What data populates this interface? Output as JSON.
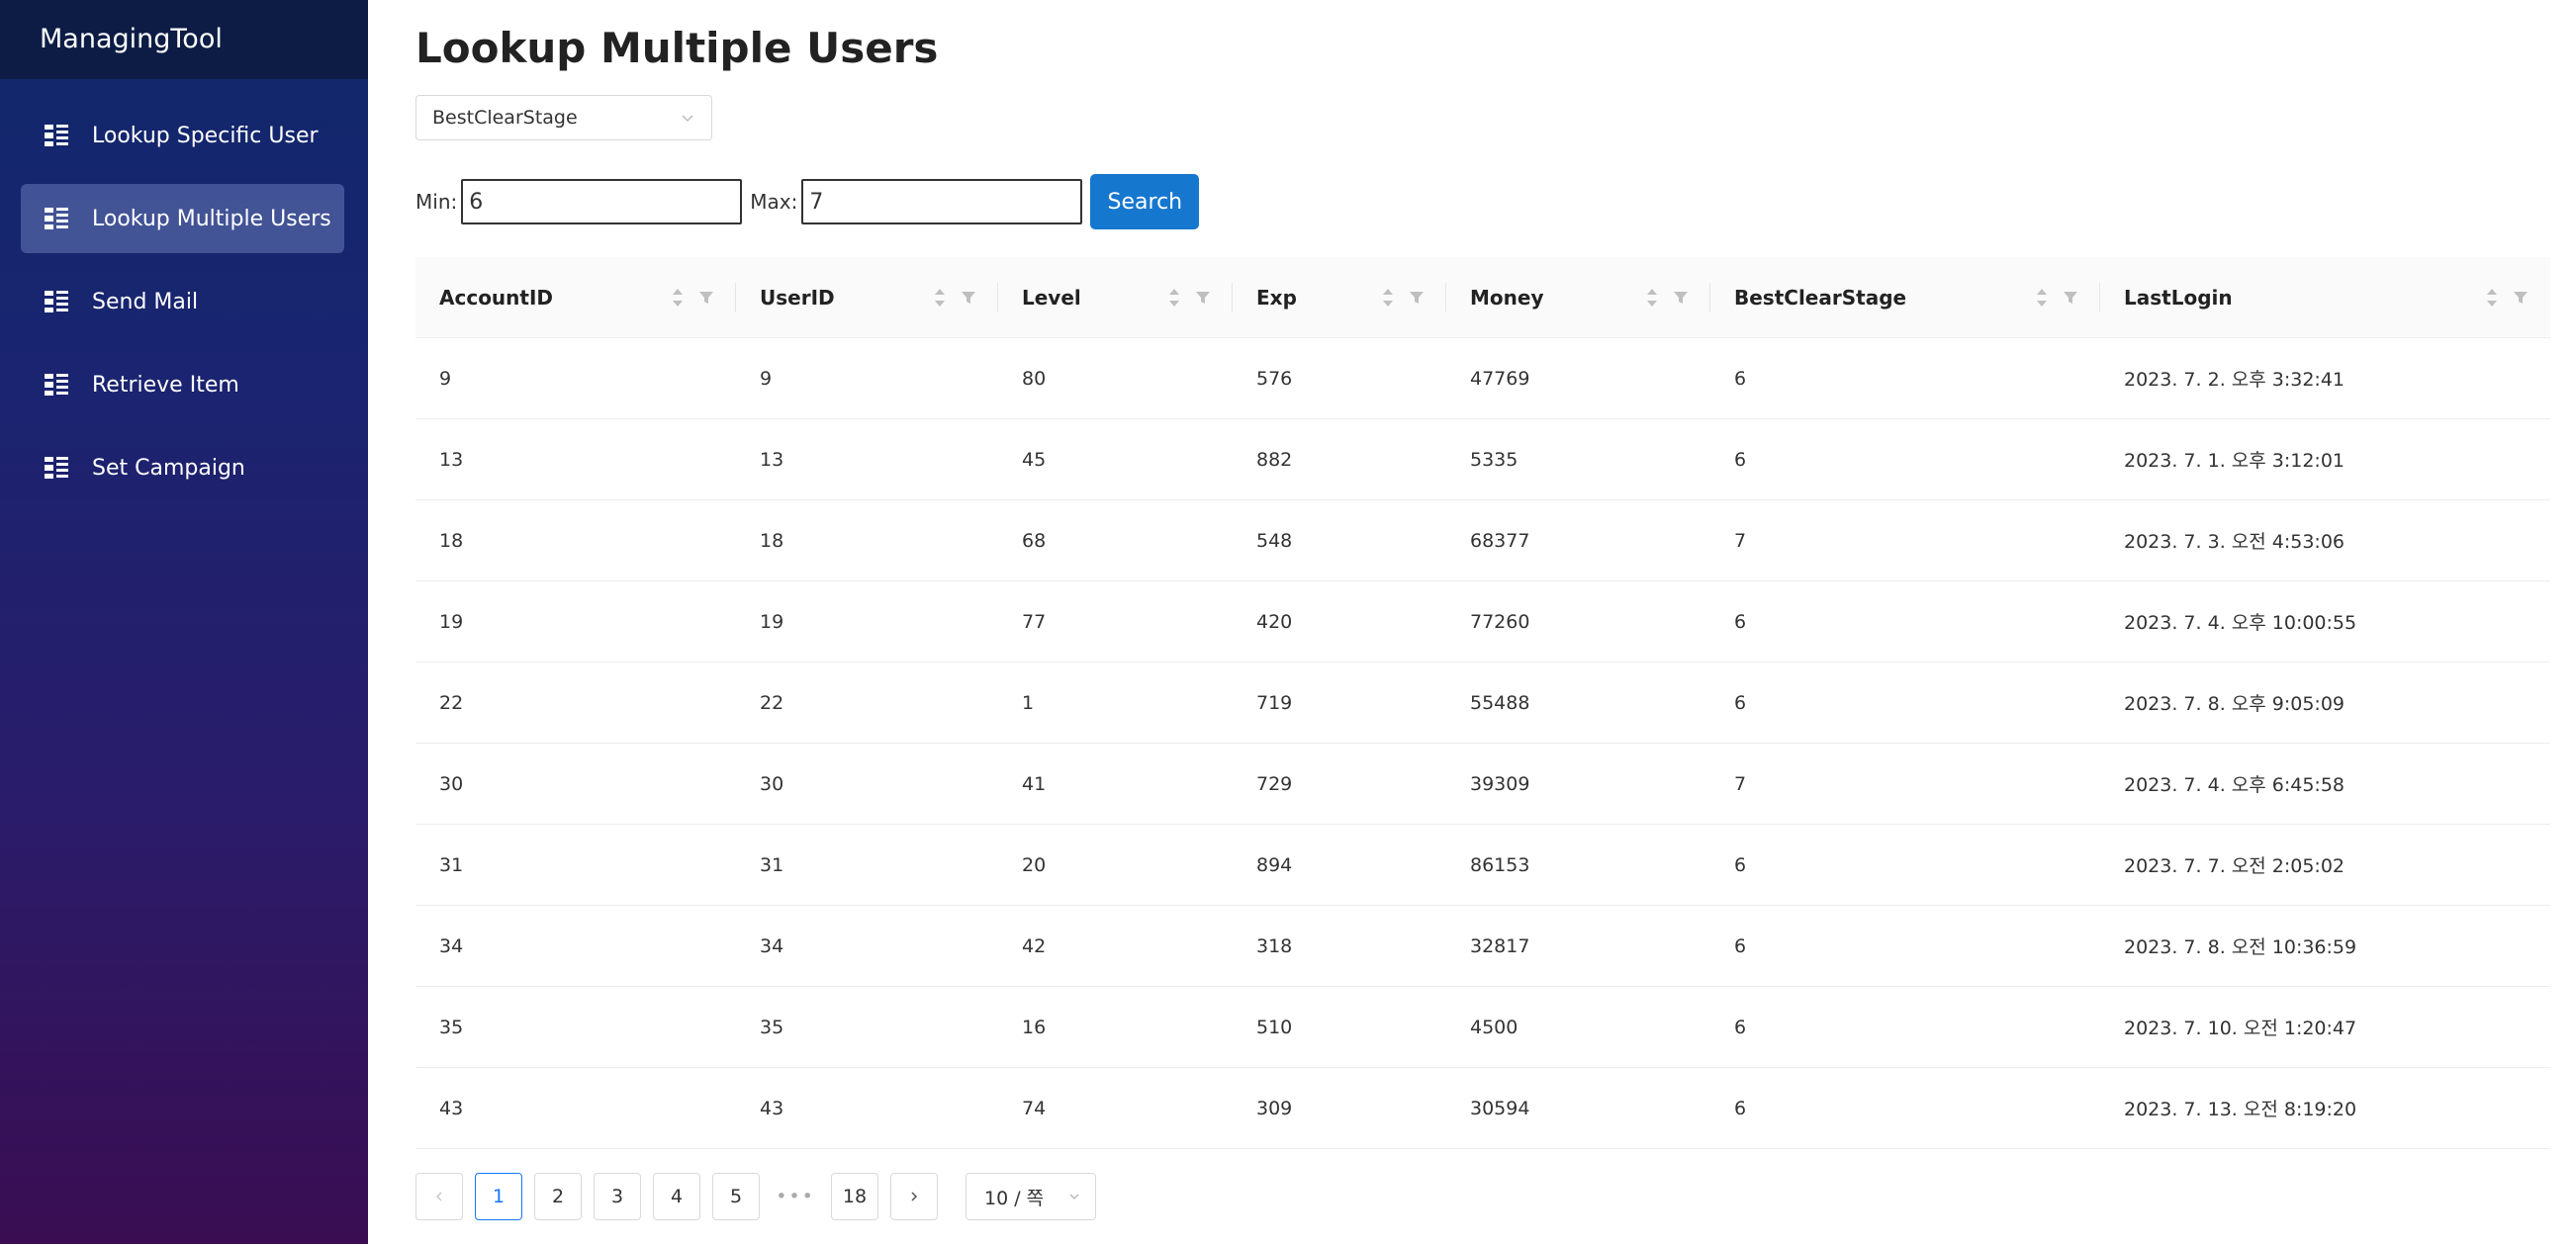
{
  "sidebar": {
    "brand": "ManagingTool",
    "items": [
      {
        "label": "Lookup Specific User",
        "icon": "list-icon"
      },
      {
        "label": "Lookup Multiple Users",
        "icon": "list-icon"
      },
      {
        "label": "Send Mail",
        "icon": "list-icon"
      },
      {
        "label": "Retrieve Item",
        "icon": "list-icon"
      },
      {
        "label": "Set Campaign",
        "icon": "list-icon"
      }
    ],
    "active_index": 1
  },
  "main": {
    "title": "Lookup Multiple Users",
    "field_select": {
      "value": "BestClearStage"
    },
    "range": {
      "min_label": "Min:",
      "min_value": "6",
      "max_label": "Max:",
      "max_value": "7",
      "search_label": "Search"
    }
  },
  "table": {
    "columns": [
      "AccountID",
      "UserID",
      "Level",
      "Exp",
      "Money",
      "BestClearStage",
      "LastLogin"
    ],
    "rows": [
      [
        "9",
        "9",
        "80",
        "576",
        "47769",
        "6",
        "2023. 7. 2. 오후 3:32:41"
      ],
      [
        "13",
        "13",
        "45",
        "882",
        "5335",
        "6",
        "2023. 7. 1. 오후 3:12:01"
      ],
      [
        "18",
        "18",
        "68",
        "548",
        "68377",
        "7",
        "2023. 7. 3. 오전 4:53:06"
      ],
      [
        "19",
        "19",
        "77",
        "420",
        "77260",
        "6",
        "2023. 7. 4. 오후 10:00:55"
      ],
      [
        "22",
        "22",
        "1",
        "719",
        "55488",
        "6",
        "2023. 7. 8. 오후 9:05:09"
      ],
      [
        "30",
        "30",
        "41",
        "729",
        "39309",
        "7",
        "2023. 7. 4. 오후 6:45:58"
      ],
      [
        "31",
        "31",
        "20",
        "894",
        "86153",
        "6",
        "2023. 7. 7. 오전 2:05:02"
      ],
      [
        "34",
        "34",
        "42",
        "318",
        "32817",
        "6",
        "2023. 7. 8. 오전 10:36:59"
      ],
      [
        "35",
        "35",
        "16",
        "510",
        "4500",
        "6",
        "2023. 7. 10. 오전 1:20:47"
      ],
      [
        "43",
        "43",
        "74",
        "309",
        "30594",
        "6",
        "2023. 7. 13. 오전 8:19:20"
      ]
    ]
  },
  "pagination": {
    "prev": "<",
    "next": ">",
    "pages": [
      "1",
      "2",
      "3",
      "4",
      "5"
    ],
    "ellipsis": "•••",
    "last_page": "18",
    "current": "1",
    "page_size": "10 / 쪽"
  },
  "colors": {
    "sidebar_top": "#10286b",
    "sidebar_bottom": "#3a0d52",
    "primary": "#1677cf"
  }
}
